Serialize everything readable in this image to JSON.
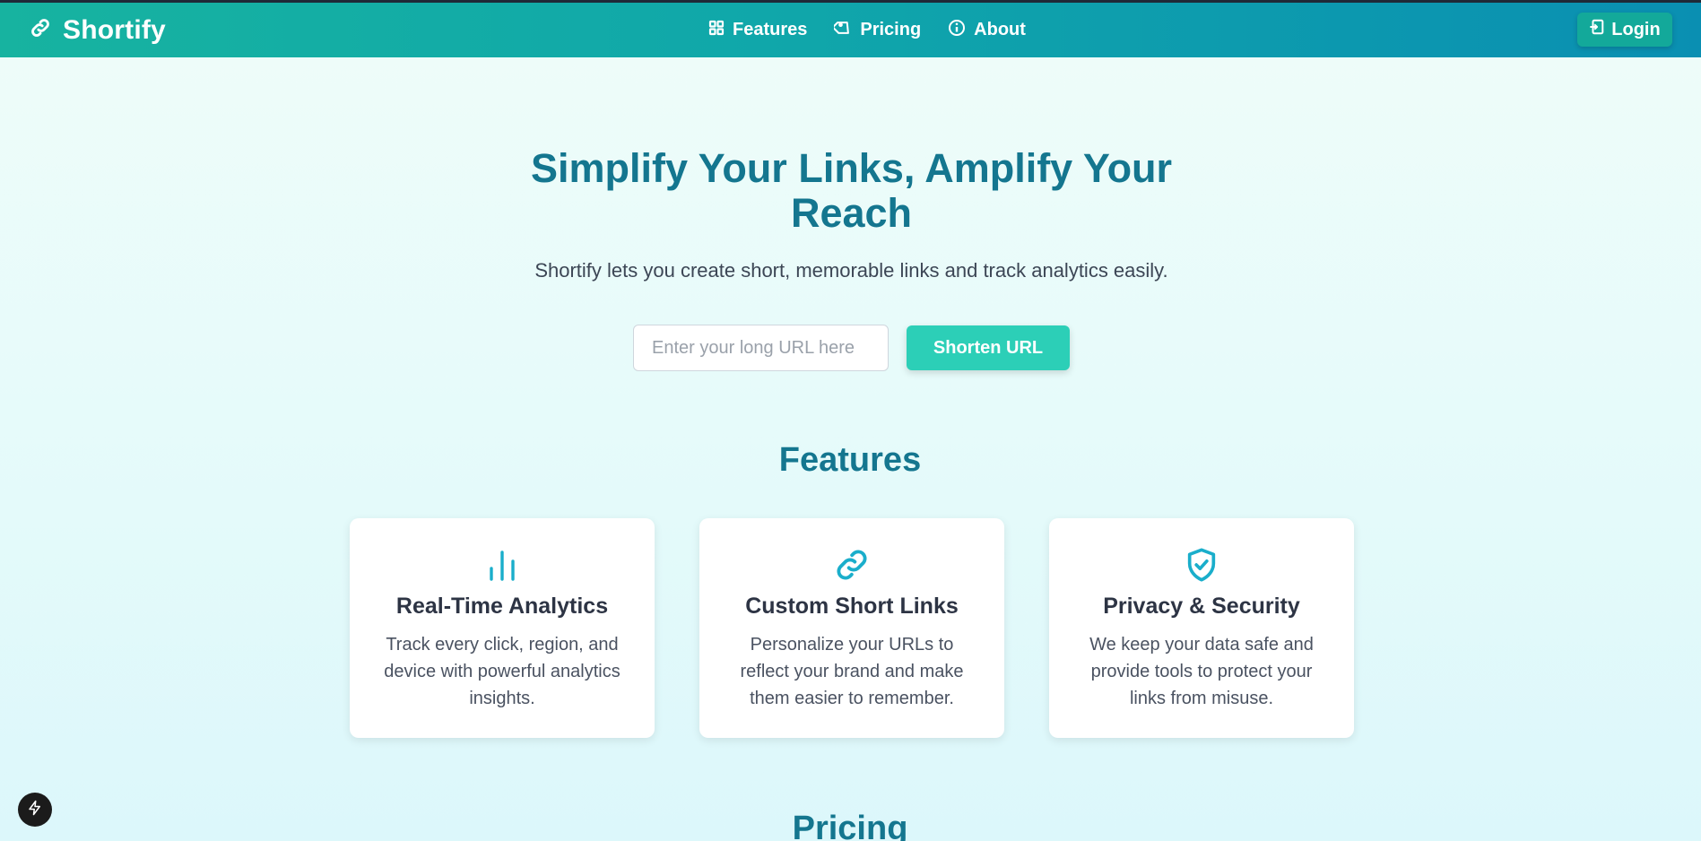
{
  "brand": {
    "name": "Shortify",
    "icon": "link-icon"
  },
  "nav": {
    "items": [
      {
        "label": "Features",
        "icon": "grid-icon"
      },
      {
        "label": "Pricing",
        "icon": "tag-icon"
      },
      {
        "label": "About",
        "icon": "info-icon"
      }
    ],
    "login_label": "Login"
  },
  "hero": {
    "title_line1": "Simplify Your Links, Amplify Your",
    "title_line2": "Reach",
    "subtitle": "Shortify lets you create short, memorable links and track analytics easily.",
    "input_placeholder": "Enter your long URL here",
    "input_value": "",
    "button_label": "Shorten URL"
  },
  "features": {
    "title": "Features",
    "cards": [
      {
        "icon": "bar-chart-icon",
        "title": "Real-Time Analytics",
        "desc": "Track every click, region, and device with powerful analytics insights."
      },
      {
        "icon": "link-icon",
        "title": "Custom Short Links",
        "desc": "Personalize your URLs to reflect your brand and make them easier to remember."
      },
      {
        "icon": "shield-check-icon",
        "title": "Privacy & Security",
        "desc": "We keep your data safe and provide tools to protect your links from misuse."
      }
    ]
  },
  "pricing": {
    "title": "Pricing"
  },
  "colors": {
    "accent": "#14768f",
    "button": "#2ccfb7",
    "icon": "#1aaecb",
    "nav_start": "#17b3a0",
    "nav_end": "#0a8fb2"
  }
}
